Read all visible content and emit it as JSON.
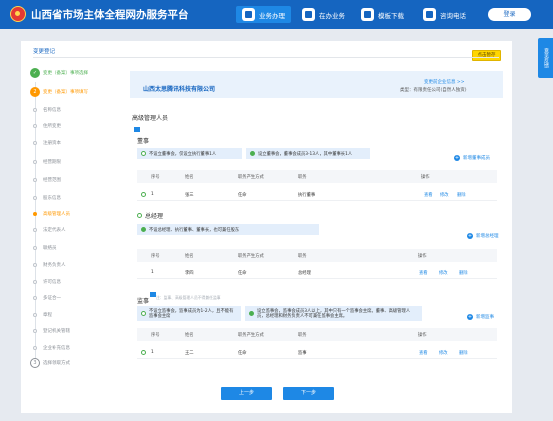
{
  "header": {
    "site_title": "山西省市场主体全程网办服务平台",
    "nav": [
      {
        "label": "业务办理",
        "icon": "business-icon"
      },
      {
        "label": "在办业务",
        "icon": "document-icon"
      },
      {
        "label": "模板下载",
        "icon": "download-icon"
      },
      {
        "label": "咨询电话",
        "icon": "phone-icon"
      }
    ],
    "login_label": "登录"
  },
  "side_tab": "意见反馈",
  "section": {
    "title": "变更登记",
    "save_label": "点击暂存"
  },
  "steps": [
    {
      "label": "变更（备案）事项选择",
      "state": "done",
      "mark": "✓"
    },
    {
      "label": "变更（备案）事项填写",
      "state": "current",
      "mark": "2"
    },
    {
      "label": "名称信息",
      "state": "sub"
    },
    {
      "label": "住所变更",
      "state": "sub"
    },
    {
      "label": "注册资本",
      "state": "sub"
    },
    {
      "label": "经营期限",
      "state": "sub"
    },
    {
      "label": "经营范围",
      "state": "sub"
    },
    {
      "label": "股东信息",
      "state": "sub"
    },
    {
      "label": "高级管理人员",
      "state": "active-sub"
    },
    {
      "label": "法定代表人",
      "state": "sub"
    },
    {
      "label": "联络员",
      "state": "sub"
    },
    {
      "label": "财务负责人",
      "state": "sub"
    },
    {
      "label": "许可信息",
      "state": "sub"
    },
    {
      "label": "多证合一",
      "state": "sub"
    },
    {
      "label": "章程",
      "state": "sub"
    },
    {
      "label": "登记机关管辖",
      "state": "sub"
    },
    {
      "label": "企业补充信息",
      "state": "sub"
    },
    {
      "label": "选择领取方式",
      "state": "num",
      "mark": "3"
    }
  ],
  "company": {
    "name": "山西太思腾讯科技有限公司",
    "link_label": "变更前企业信息 >>",
    "type_text": "类型：有限责任公司(自然人独资)"
  },
  "main_title": "高级管理人员",
  "board": {
    "title": "董事",
    "options": [
      "不设立董事会，仅设立执行董事1人",
      "设立董事会，董事会成员3-13人，其中董事长1人"
    ],
    "add_label": "新增董事成员",
    "headers": [
      "序号",
      "姓名",
      "职务产生方式",
      "职务",
      "操作"
    ],
    "rows": [
      [
        "1",
        "张三",
        "任命",
        "执行董事"
      ]
    ],
    "actions": [
      "查看",
      "修改",
      "删除"
    ]
  },
  "manager": {
    "title": "总经理",
    "option": "不设总经理、执行董事、董事长，也可兼任股东",
    "add_label": "新增总经理",
    "headers": [
      "序号",
      "姓名",
      "职务产生方式",
      "职务",
      "操作"
    ],
    "rows": [
      [
        "1",
        "李四",
        "任命",
        "总经理"
      ]
    ],
    "actions": [
      "查看",
      "修改",
      "删除"
    ]
  },
  "supervisor": {
    "title": "监事",
    "hint": "注：监事、高级管理人员不得兼任监事",
    "options": [
      "不设立监事会，监事成员为1-2人，且不能有监事会主席",
      "设立监事会，监事会成员3人以上，其中只有一个监事会主席。董事、高级管理人员，总经理和财务负责人不可兼任监事会主席。"
    ],
    "add_label": "新增监事",
    "headers": [
      "序号",
      "姓名",
      "职务产生方式",
      "职务",
      "操作"
    ],
    "rows": [
      [
        "1",
        "王二",
        "任命",
        "监事"
      ]
    ],
    "actions": [
      "查看",
      "修改",
      "删除"
    ]
  },
  "footer": {
    "prev_label": "上一步",
    "next_label": "下一步"
  }
}
